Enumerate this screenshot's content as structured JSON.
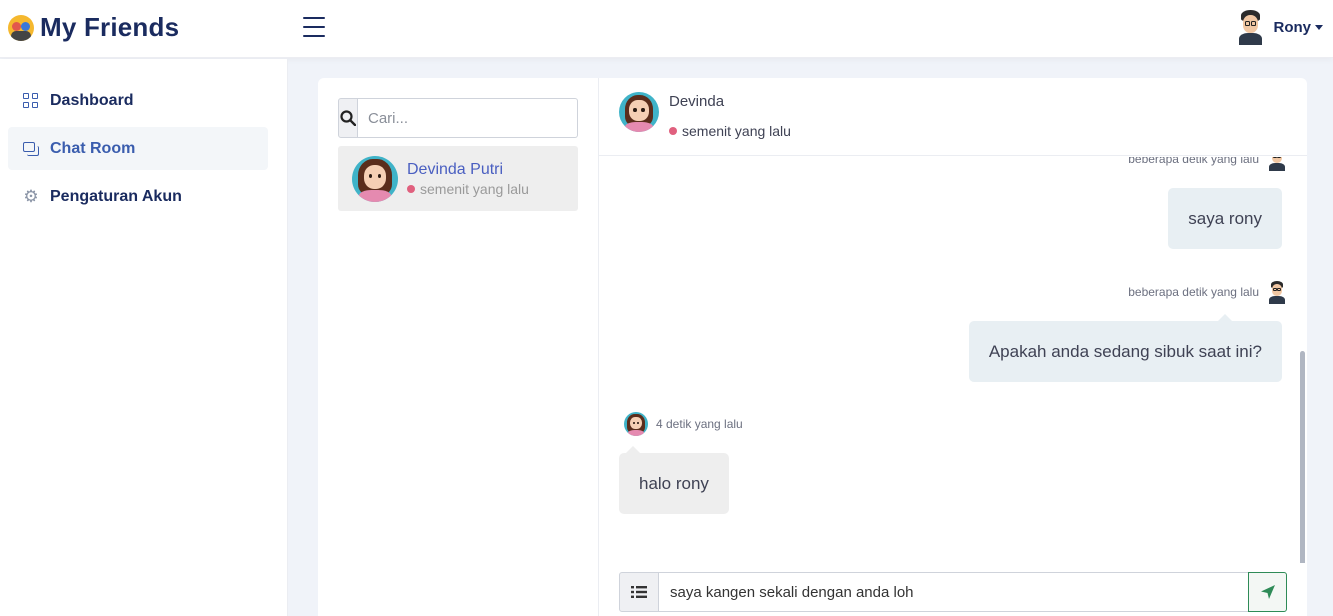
{
  "app": {
    "title": "My Friends"
  },
  "user": {
    "name": "Rony"
  },
  "sidebar": {
    "items": [
      {
        "label": "Dashboard",
        "icon": "grid-icon"
      },
      {
        "label": "Chat Room",
        "icon": "chat-icon",
        "active": true
      },
      {
        "label": "Pengaturan Akun",
        "icon": "gear-icon"
      }
    ]
  },
  "search": {
    "placeholder": "Cari..."
  },
  "contacts": [
    {
      "name": "Devinda Putri",
      "status": "semenit yang lalu"
    }
  ],
  "chat": {
    "header": {
      "name": "Devinda",
      "status": "semenit yang lalu"
    },
    "messages": [
      {
        "direction": "out",
        "time": "beberapa detik yang lalu",
        "text": "saya rony"
      },
      {
        "direction": "out",
        "time": "beberapa detik yang lalu",
        "text": "Apakah anda sedang sibuk saat ini?"
      },
      {
        "direction": "in",
        "time": "4 detik yang lalu",
        "text": "halo rony"
      }
    ],
    "composer": {
      "value": "saya kangen sekali dengan anda loh"
    }
  },
  "colors": {
    "brand": "#1a2b5f",
    "accent": "#3a5dae",
    "online_dot": "#e0607e",
    "send": "#2e8b57"
  }
}
